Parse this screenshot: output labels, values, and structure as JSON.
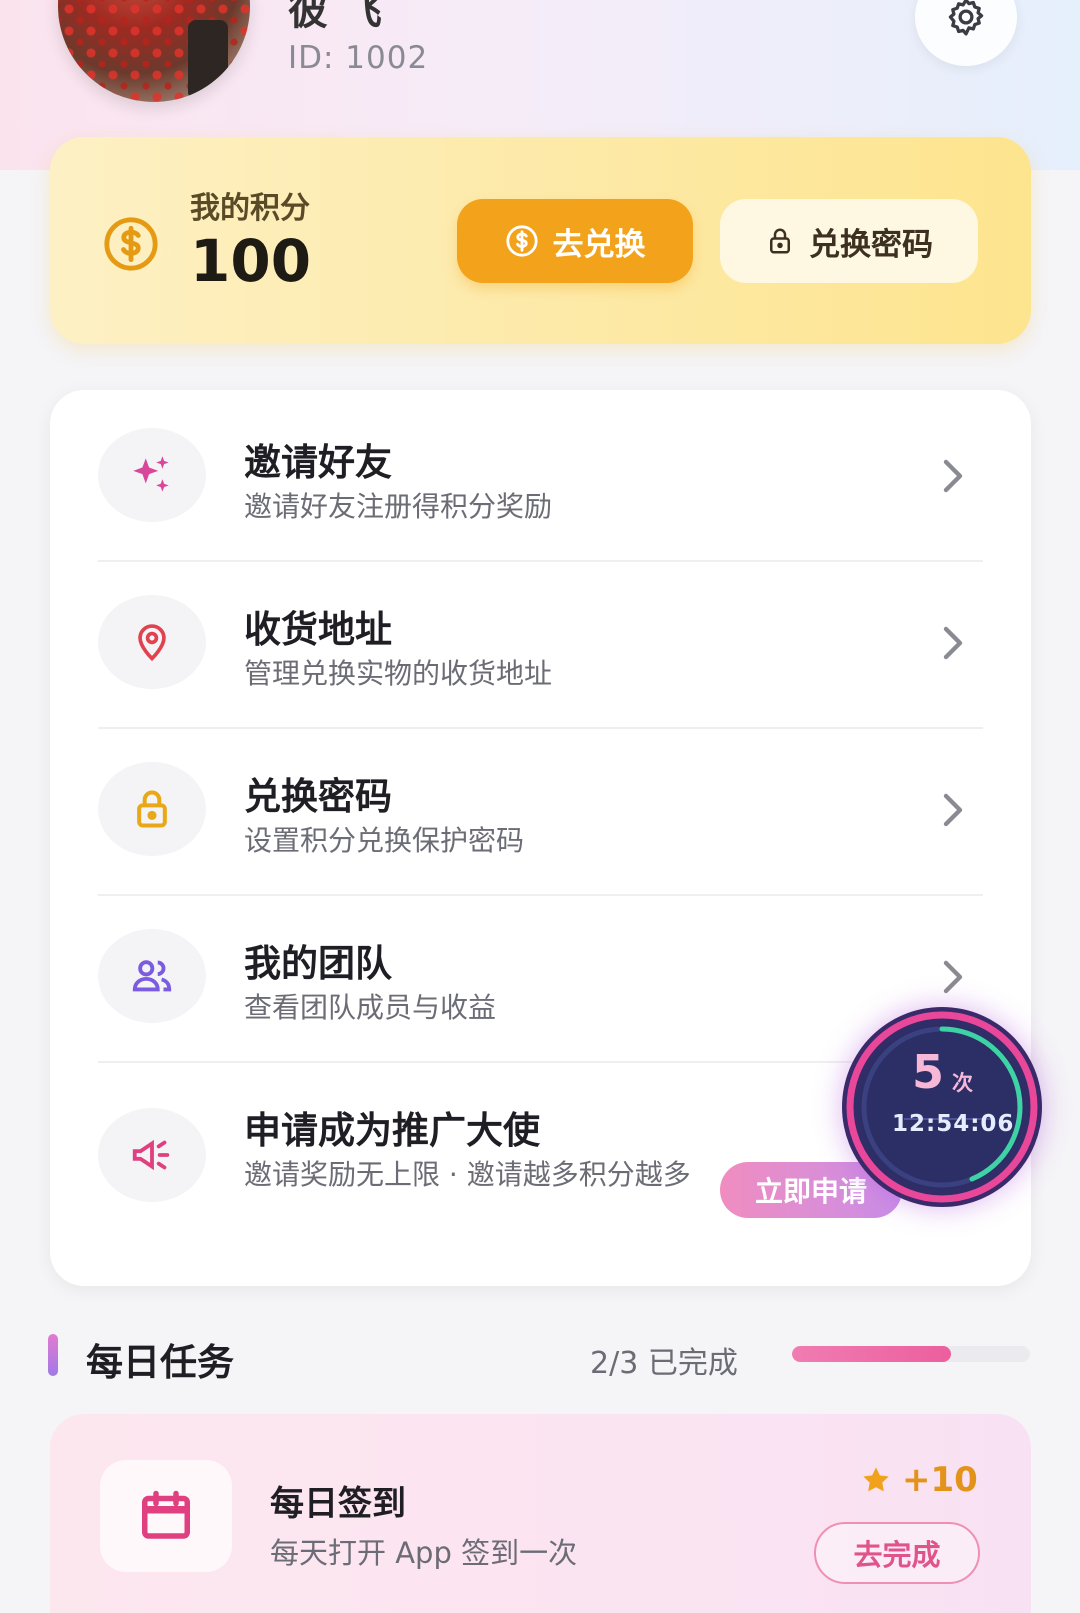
{
  "profile": {
    "username": "彼 飞",
    "id_text": "ID: 1002"
  },
  "points": {
    "label": "我的积分",
    "value": "100",
    "redeem_label": "去兑换",
    "password_label": "兑换密码"
  },
  "menu": {
    "items": [
      {
        "title": "邀请好友",
        "desc": "邀请好友注册得积分奖励",
        "icon": "sparkles-icon",
        "color": "#d9479a"
      },
      {
        "title": "收货地址",
        "desc": "管理兑换实物的收货地址",
        "icon": "location-pin-icon",
        "color": "#e0424f"
      },
      {
        "title": "兑换密码",
        "desc": "设置积分兑换保护密码",
        "icon": "lock-icon",
        "color": "#e9a818"
      },
      {
        "title": "我的团队",
        "desc": "查看团队成员与收益",
        "icon": "team-icon",
        "color": "#7b5be0"
      },
      {
        "title": "申请成为推广大使",
        "desc": "邀请奖励无上限 · 邀请越多积分越多",
        "icon": "megaphone-icon",
        "color": "#e0407f",
        "badge": "立即申请"
      }
    ]
  },
  "timer": {
    "count": "5",
    "unit": "次",
    "clock": "12:54:06"
  },
  "daily_tasks": {
    "title": "每日任务",
    "status": "2/3 已完成",
    "progress": 0.667
  },
  "task": {
    "title": "每日签到",
    "desc": "每天打开 App 签到一次",
    "reward": "+10",
    "button": "去完成"
  },
  "colors": {
    "accent_orange": "#f2a21b",
    "accent_pink": "#ec5f9e",
    "accent_purple": "#a07ae6"
  }
}
